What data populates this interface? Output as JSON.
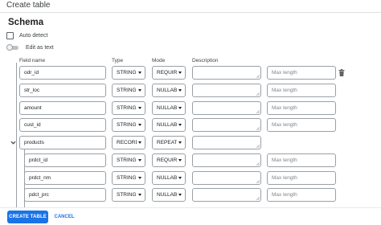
{
  "window": {
    "title": "Create table"
  },
  "schema": {
    "heading": "Schema",
    "auto_detect_label": "Auto detect",
    "edit_as_text_label": "Edit as text"
  },
  "columns": {
    "field_name": "Field name",
    "type": "Type",
    "mode": "Mode",
    "description": "Description"
  },
  "rows": [
    {
      "name": "odr_id",
      "type": "STRING",
      "mode": "REQUIRED",
      "max_length_placeholder": "Max length"
    },
    {
      "name": "str_loc",
      "type": "STRING",
      "mode": "NULLAB...",
      "max_length_placeholder": "Max length"
    },
    {
      "name": "amount",
      "type": "STRING",
      "mode": "NULLAB...",
      "max_length_placeholder": "Max length"
    },
    {
      "name": "cust_id",
      "type": "STRING",
      "mode": "NULLAB...",
      "max_length_placeholder": "Max length"
    },
    {
      "name": "products",
      "type": "RECORD",
      "mode": "REPEAT..."
    },
    {
      "name": "prdct_id",
      "type": "STRING",
      "mode": "REQUIRED",
      "max_length_placeholder": "Max length"
    },
    {
      "name": "prdct_nm",
      "type": "STRING",
      "mode": "NULLAB...",
      "max_length_placeholder": "Max length"
    },
    {
      "name": "pdct_prc",
      "type": "STRING",
      "mode": "NULLAB...",
      "max_length_placeholder": "Max length"
    }
  ],
  "icons": {
    "delete": "trash-icon",
    "expand": "chevron-down-icon",
    "resize": "resize-grip-icon"
  },
  "footer": {
    "create_label": "CREATE TABLE",
    "cancel_label": "CANCEL"
  },
  "colors": {
    "accent": "#1a73e8",
    "border": "#9aa0a6"
  }
}
